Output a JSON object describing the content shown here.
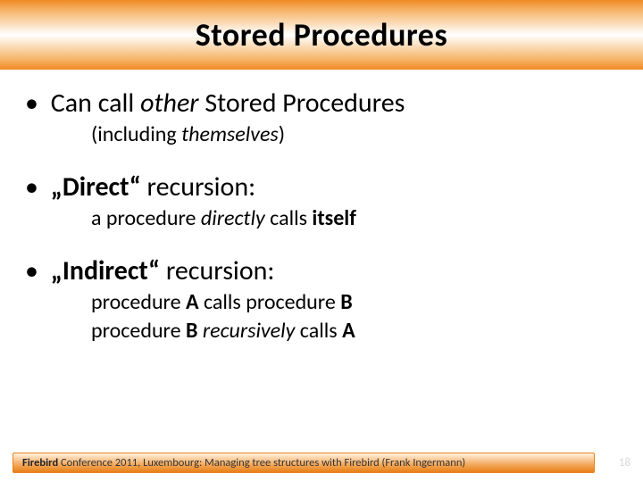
{
  "title": "Stored Procedures",
  "bullets": [
    {
      "lead": "Can call ",
      "em": "other",
      "tail": " Stored Procedures",
      "sub_pre": "(including ",
      "sub_em": "themselves",
      "sub_post": ")"
    },
    {
      "head_bold": "„Direct“",
      "head_tail": " recursion:",
      "sub_pre": "a procedure ",
      "sub_em": "directly",
      "sub_mid": " calls ",
      "sub_bold": "itself"
    },
    {
      "head_bold": "„Indirect“",
      "head_tail": " recursion:",
      "line1_pre": "procedure ",
      "line1_b1": "A",
      "line1_mid": " calls procedure ",
      "line1_b2": "B",
      "line2_pre": "procedure ",
      "line2_b1": "B",
      "line2_mid": " ",
      "line2_em": "recursively",
      "line2_mid2": " calls ",
      "line2_b2": "A"
    }
  ],
  "footer": {
    "brand": "Firebird",
    "rest": " Conference 2011, Luxembourg:  Managing tree structures with Firebird  (Frank Ingermann)"
  },
  "page_number": "18"
}
